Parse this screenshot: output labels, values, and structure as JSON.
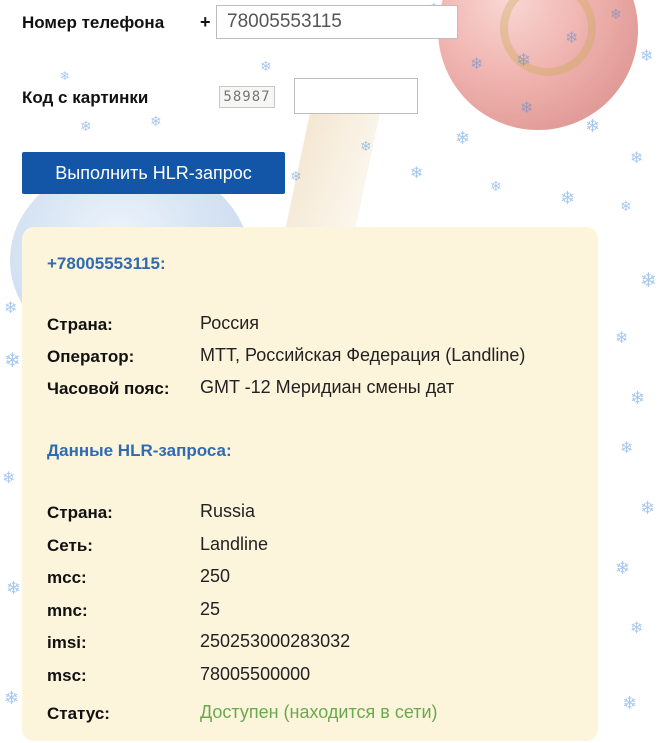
{
  "form": {
    "phone_label": "Номер телефона",
    "phone_prefix": "+",
    "phone_value": "78005553115",
    "captcha_label": "Код с картинки",
    "captcha_text": "58987",
    "captcha_value": "",
    "submit_label": "Выполнить HLR-запрос"
  },
  "result": {
    "number_heading": "+78005553115:",
    "info": [
      {
        "key": "Страна:",
        "value": "Россия"
      },
      {
        "key": "Оператор:",
        "value": "МТТ, Российская Федерация (Landline)"
      },
      {
        "key": "Часовой пояс:",
        "value": "GMT -12 Меридиан смены дат"
      }
    ],
    "hlr_heading": "Данные HLR-запроса:",
    "hlr": [
      {
        "key": "Страна:",
        "value": "Russia"
      },
      {
        "key": "Сеть:",
        "value": "Landline"
      },
      {
        "key": "mcc:",
        "value": "250"
      },
      {
        "key": "mnc:",
        "value": "25"
      },
      {
        "key": "imsi:",
        "value": "250253000283032"
      },
      {
        "key": "msc:",
        "value": "78005500000"
      },
      {
        "key": "Статус:",
        "value": "Доступен (находится в сети)"
      }
    ]
  },
  "colors": {
    "button": "#1356a8",
    "card": "#fdf4dc",
    "heading": "#2f6bb3",
    "status_ok": "#6aa84f"
  },
  "icons": [
    "snowflake-icon",
    "ornament-decoration"
  ]
}
